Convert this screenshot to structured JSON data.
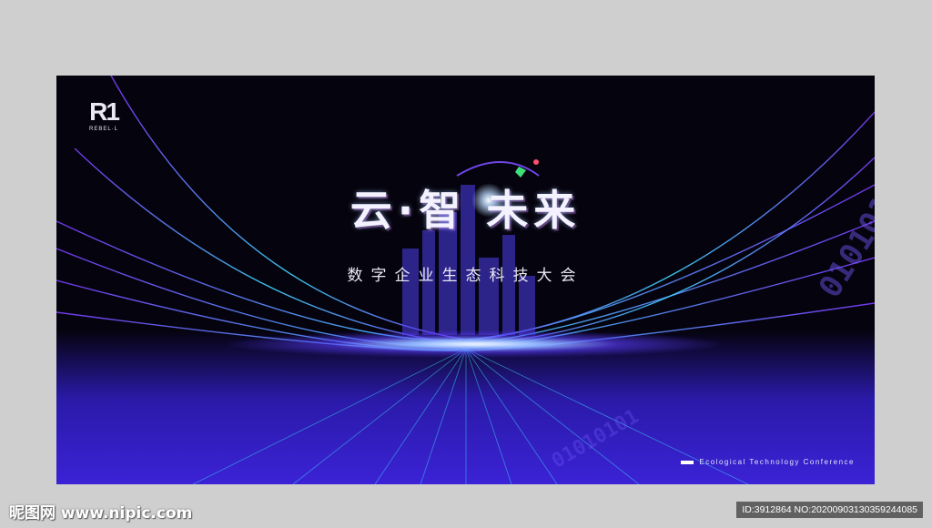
{
  "logo": {
    "mark": "R1",
    "text": "REBEL·L"
  },
  "title": "云·智 未来",
  "subtitle": "数字企业生态科技大会",
  "tagline": "Ecological Technology Conference",
  "binary_decor": "01010101",
  "watermark": {
    "left": "昵图网 www.nipic.com",
    "right": "ID:3912864 NO:20200903130359244085"
  },
  "colors": {
    "background": "#05030d",
    "accent_purple": "#3b22d6",
    "accent_cyan": "#3fd6ff",
    "page_border": "#cfcfcf"
  }
}
